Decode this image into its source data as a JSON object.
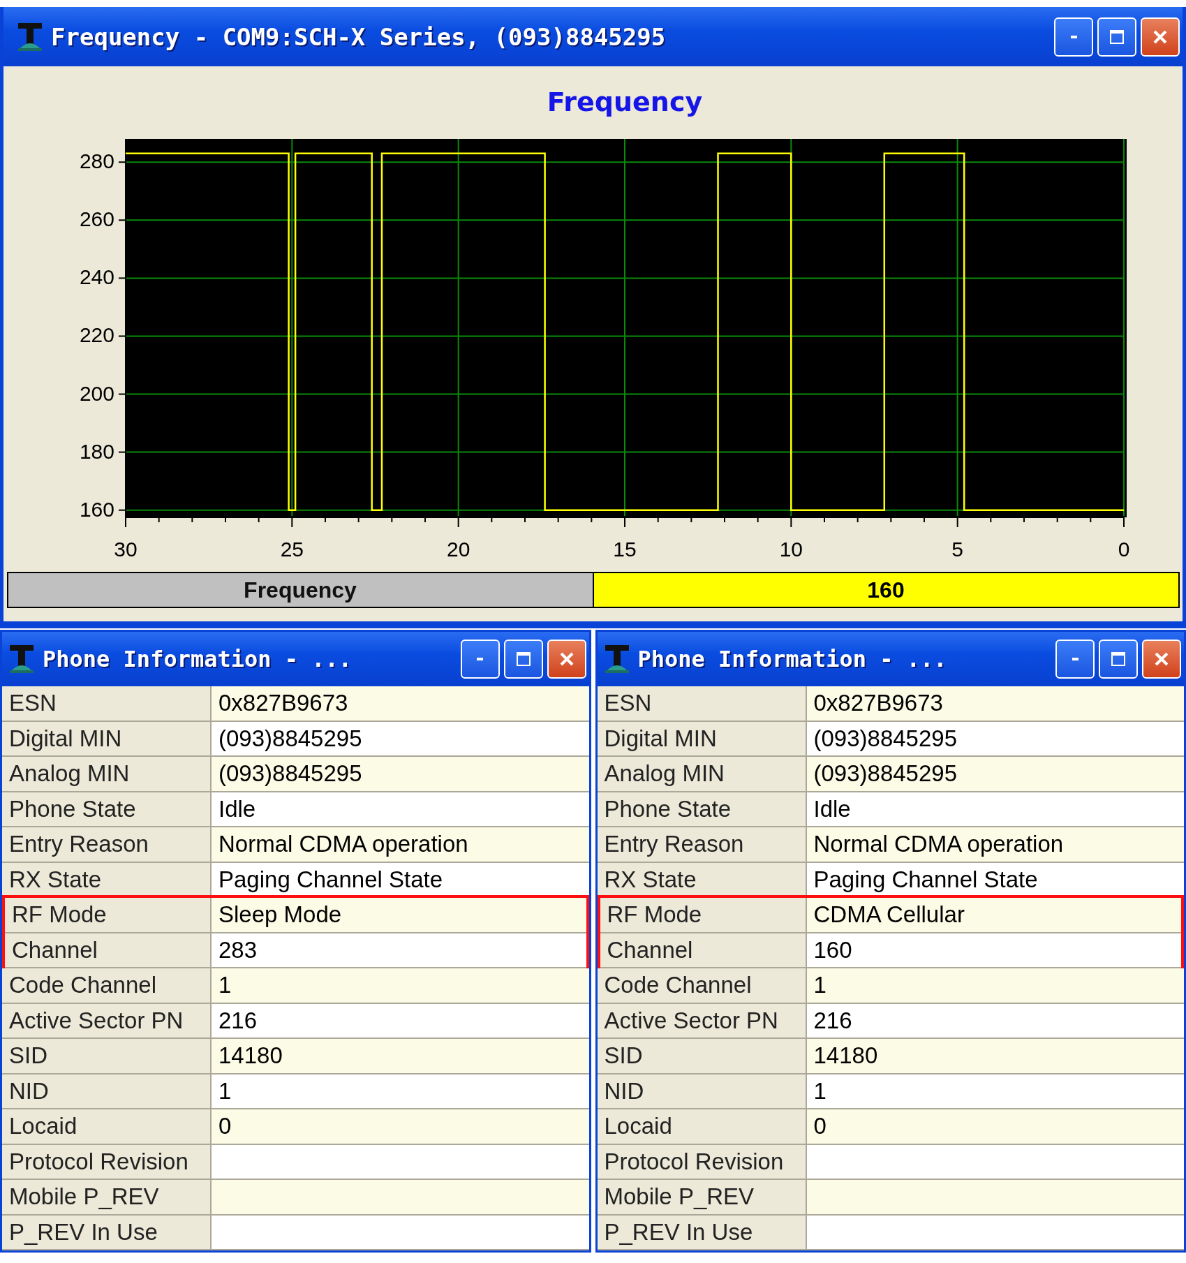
{
  "window": {
    "title": "Frequency - COM9:SCH-X Series, (093)8845295"
  },
  "chart_panel": {
    "chart_data": {
      "type": "line",
      "title": "Frequency",
      "xlim": [
        30,
        0
      ],
      "ylim": [
        158,
        288
      ],
      "xticks": [
        30,
        25,
        20,
        15,
        10,
        5,
        0
      ],
      "yticks": [
        160,
        180,
        200,
        220,
        240,
        260,
        280
      ],
      "x": [
        30,
        25.1,
        25.1,
        24.9,
        24.9,
        22.6,
        22.6,
        22.3,
        22.3,
        17.4,
        17.4,
        12.2,
        12.2,
        10,
        10,
        7.2,
        7.2,
        4.8,
        4.8,
        0
      ],
      "grid": true,
      "series": [
        {
          "color": "#ffff00",
          "values": [
            283,
            283,
            160,
            160,
            283,
            283,
            160,
            160,
            283,
            283,
            160,
            160,
            283,
            283,
            160,
            160,
            283,
            283,
            160,
            160
          ]
        }
      ]
    }
  },
  "status": {
    "label": "Frequency",
    "value": "160"
  },
  "info_windows": [
    {
      "title": "Phone Information - ...",
      "rows": [
        {
          "label": "ESN",
          "value": "0x827B9673",
          "highlighted": false
        },
        {
          "label": "Digital MIN",
          "value": "(093)8845295",
          "highlighted": false
        },
        {
          "label": "Analog MIN",
          "value": "(093)8845295",
          "highlighted": false
        },
        {
          "label": "Phone State",
          "value": "Idle",
          "highlighted": false
        },
        {
          "label": "Entry Reason",
          "value": "Normal CDMA operation",
          "highlighted": false
        },
        {
          "label": "RX State",
          "value": "Paging Channel State",
          "highlighted": false
        },
        {
          "label": "RF Mode",
          "value": "Sleep Mode",
          "highlighted": true
        },
        {
          "label": "Channel",
          "value": "283",
          "highlighted": true
        },
        {
          "label": "Code Channel",
          "value": "1",
          "highlighted": false
        },
        {
          "label": "Active Sector PN",
          "value": "216",
          "highlighted": false
        },
        {
          "label": "SID",
          "value": "14180",
          "highlighted": false
        },
        {
          "label": "NID",
          "value": "1",
          "highlighted": false
        },
        {
          "label": "Locaid",
          "value": "0",
          "highlighted": false
        },
        {
          "label": "Protocol Revision",
          "highlighted": false
        },
        {
          "label": "Mobile P_REV",
          "highlighted": false
        },
        {
          "label": "P_REV In Use",
          "highlighted": false
        }
      ]
    },
    {
      "title": "Phone Information - ...",
      "rows": [
        {
          "label": "ESN",
          "value": "0x827B9673",
          "highlighted": false
        },
        {
          "label": "Digital MIN",
          "value": "(093)8845295",
          "highlighted": false
        },
        {
          "label": "Analog MIN",
          "value": "(093)8845295",
          "highlighted": false
        },
        {
          "label": "Phone State",
          "value": "Idle",
          "highlighted": false
        },
        {
          "label": "Entry Reason",
          "value": "Normal CDMA operation",
          "highlighted": false
        },
        {
          "label": "RX State",
          "value": "Paging Channel State",
          "highlighted": false
        },
        {
          "label": "RF Mode",
          "value": "CDMA Cellular",
          "highlighted": true
        },
        {
          "label": "Channel",
          "value": "160",
          "highlighted": true
        },
        {
          "label": "Code Channel",
          "value": "1",
          "highlighted": false
        },
        {
          "label": "Active Sector PN",
          "value": "216",
          "highlighted": false
        },
        {
          "label": "SID",
          "value": "14180",
          "highlighted": false
        },
        {
          "label": "NID",
          "value": "1",
          "highlighted": false
        },
        {
          "label": "Locaid",
          "value": "0",
          "highlighted": false
        },
        {
          "label": "Protocol Revision",
          "highlighted": false
        },
        {
          "label": "Mobile P_REV",
          "highlighted": false
        },
        {
          "label": "P_REV In Use",
          "highlighted": false
        }
      ]
    }
  ]
}
